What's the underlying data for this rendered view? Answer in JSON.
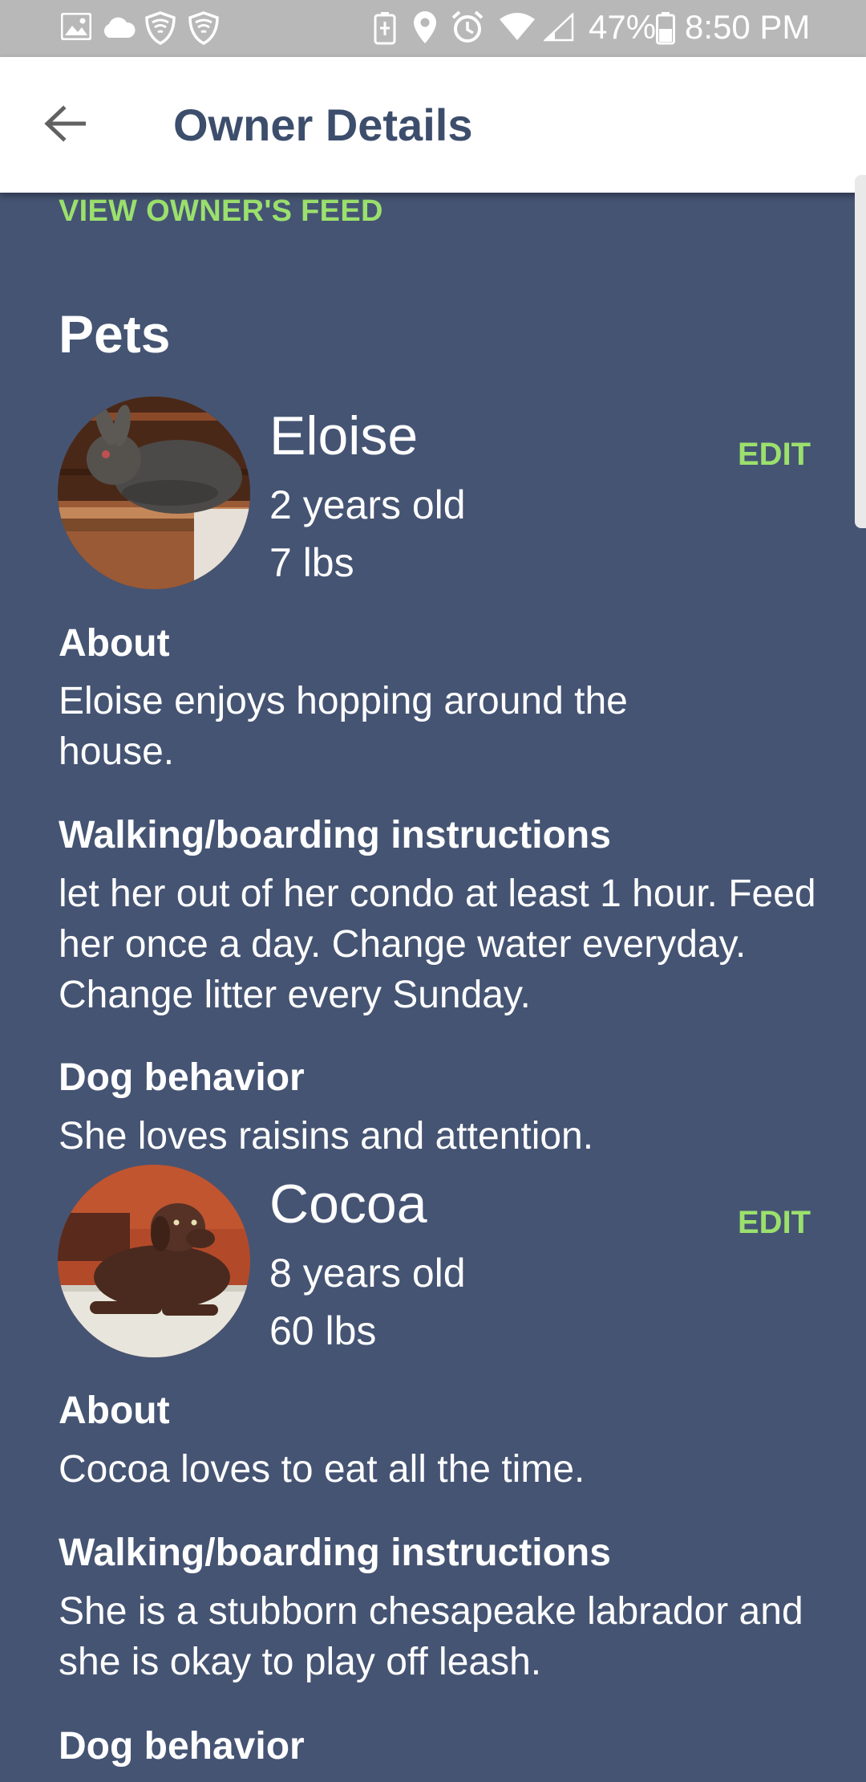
{
  "status_bar": {
    "battery": "47%",
    "time": "8:50 PM",
    "left_icons": [
      "image-icon",
      "cloud-icon",
      "shield-icon",
      "shield-icon"
    ],
    "right_icons": [
      "battery-saver-icon",
      "location-icon",
      "alarm-icon",
      "wifi-icon",
      "signal-icon",
      "battery-icon"
    ]
  },
  "app_bar": {
    "back_icon": "back-arrow-icon",
    "title": "Owner Details"
  },
  "links": {
    "view_feed": "VIEW OWNER'S FEED"
  },
  "section": {
    "title": "Pets"
  },
  "pets": [
    {
      "name": "Eloise",
      "age": "2 years old",
      "weight": "7 lbs",
      "edit_label": "EDIT",
      "about_label": "About",
      "about": "Eloise enjoys hopping around the house.",
      "instructions_label": "Walking/boarding instructions",
      "instructions": "let her out of her condo at least 1 hour. Feed her once a day. Change water everyday. Change litter every Sunday.",
      "behavior_label": "Dog behavior",
      "behavior": "She loves raisins and attention."
    },
    {
      "name": "Cocoa",
      "age": "8 years old",
      "weight": "60 lbs",
      "edit_label": "EDIT",
      "about_label": "About",
      "about": "Cocoa loves to eat all the time.",
      "instructions_label": "Walking/boarding instructions",
      "instructions": "She is a stubborn chesapeake labrador and she is okay to play off leash.",
      "behavior_label": "Dog behavior"
    }
  ],
  "colors": {
    "background": "#455473",
    "accent": "#9be06d",
    "title": "#3d4e6c",
    "status_bar": "#b8b8b8"
  }
}
